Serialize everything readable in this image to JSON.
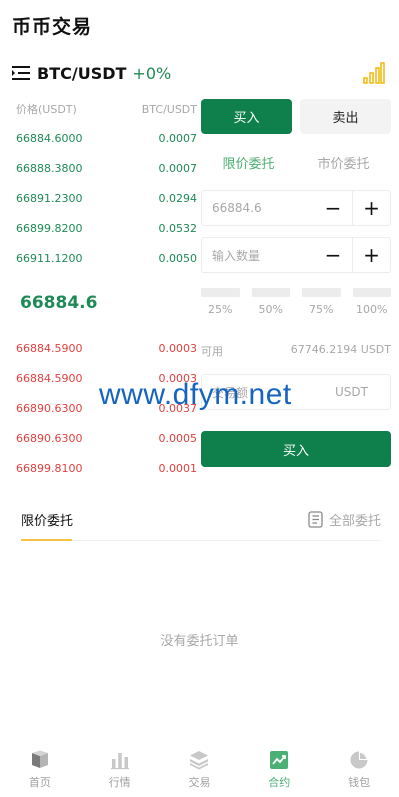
{
  "page": {
    "title": "币币交易"
  },
  "pair": {
    "name": "BTC/USDT",
    "change": "+0%"
  },
  "orderbook": {
    "price_header": "价格(USDT)",
    "amount_header": "BTC/USDT",
    "buy_rows": [
      {
        "price": "66884.6000",
        "amount": "0.0007"
      },
      {
        "price": "66888.3800",
        "amount": "0.0007"
      },
      {
        "price": "66891.2300",
        "amount": "0.0294"
      },
      {
        "price": "66899.8200",
        "amount": "0.0532"
      },
      {
        "price": "66911.1200",
        "amount": "0.0050"
      }
    ],
    "last_price": "66884.6",
    "sell_rows": [
      {
        "price": "66884.5900",
        "amount": "0.0003"
      },
      {
        "price": "66884.5900",
        "amount": "0.0003"
      },
      {
        "price": "66890.6300",
        "amount": "0.0037"
      },
      {
        "price": "66890.6300",
        "amount": "0.0005"
      },
      {
        "price": "66899.8100",
        "amount": "0.0001"
      }
    ]
  },
  "form": {
    "side_tabs": {
      "buy": "买入",
      "sell": "卖出"
    },
    "type_tabs": {
      "limit": "限价委托",
      "market": "市价委托"
    },
    "price": {
      "value": "66884.6",
      "minus": "−",
      "plus": "+"
    },
    "quantity": {
      "placeholder": "输入数量",
      "minus": "−",
      "plus": "+"
    },
    "percentages": [
      "25%",
      "50%",
      "75%",
      "100%"
    ],
    "available": {
      "label": "可用",
      "value": "67746.2194 USDT"
    },
    "amount": {
      "label": "交易额",
      "unit": "USDT"
    },
    "submit_label": "买入"
  },
  "watermark": "www.dfym.net",
  "orders": {
    "active_tab": "限价委托",
    "all_label": "全部委托",
    "empty_text": "没有委托订单"
  },
  "nav": [
    {
      "label": "首页",
      "icon": "home-icon"
    },
    {
      "label": "行情",
      "icon": "market-icon"
    },
    {
      "label": "交易",
      "icon": "trade-icon"
    },
    {
      "label": "合约",
      "icon": "contract-icon"
    },
    {
      "label": "钱包",
      "icon": "wallet-icon"
    }
  ],
  "colors": {
    "primary": "#0f7f4b",
    "buy": "#1e8a55",
    "sell": "#e0413f",
    "accent": "#f5c342",
    "active_tab": "#4caf73"
  }
}
